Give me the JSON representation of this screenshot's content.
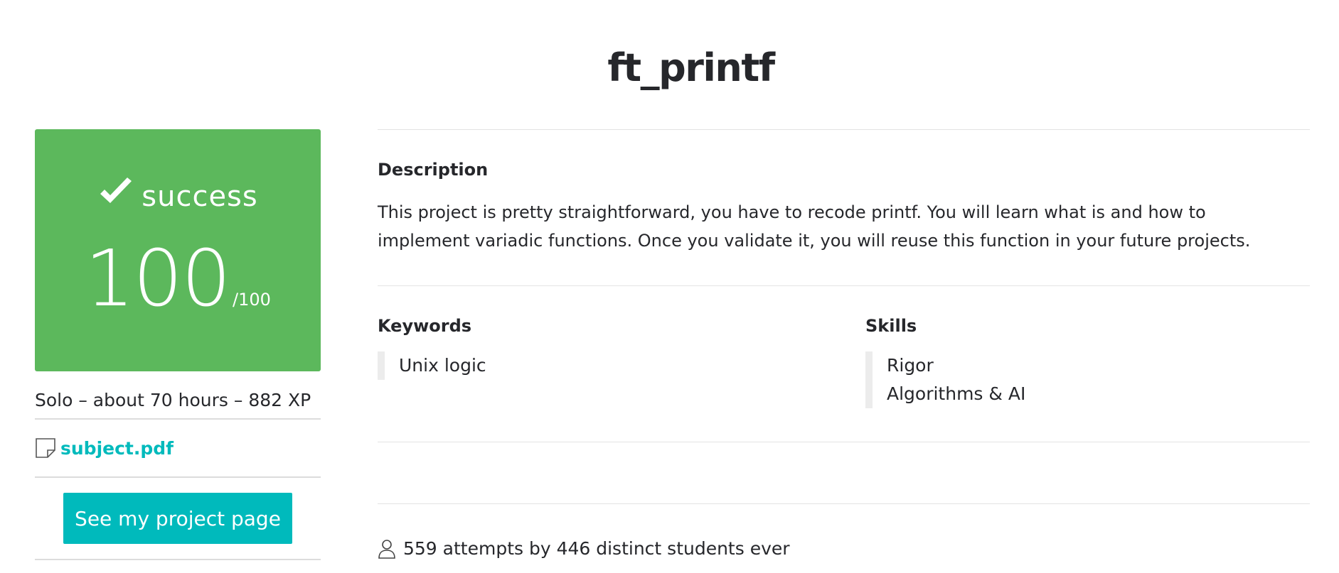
{
  "project": {
    "title": "ft_printf"
  },
  "status": {
    "label": "success",
    "score": "100",
    "max": "/100",
    "color": "#5cb85c",
    "icon": "check-icon"
  },
  "meta": {
    "summary": "Solo – about 70 hours – 882 XP"
  },
  "subject": {
    "icon": "document-icon",
    "link_label": "subject.pdf"
  },
  "actions": {
    "project_page_label": "See my project page",
    "accent": "#00babc"
  },
  "description": {
    "heading": "Description",
    "text": "This project is pretty straightforward, you have to recode printf. You will learn what is and how to implement variadic functions. Once you validate it, you will reuse this function in your future projects."
  },
  "keywords": {
    "heading": "Keywords",
    "items": [
      "Unix logic"
    ]
  },
  "skills": {
    "heading": "Skills",
    "items": [
      "Rigor",
      "Algorithms & AI"
    ]
  },
  "stats": {
    "icon": "user-icon",
    "text": "559 attempts by 446 distinct students ever"
  }
}
